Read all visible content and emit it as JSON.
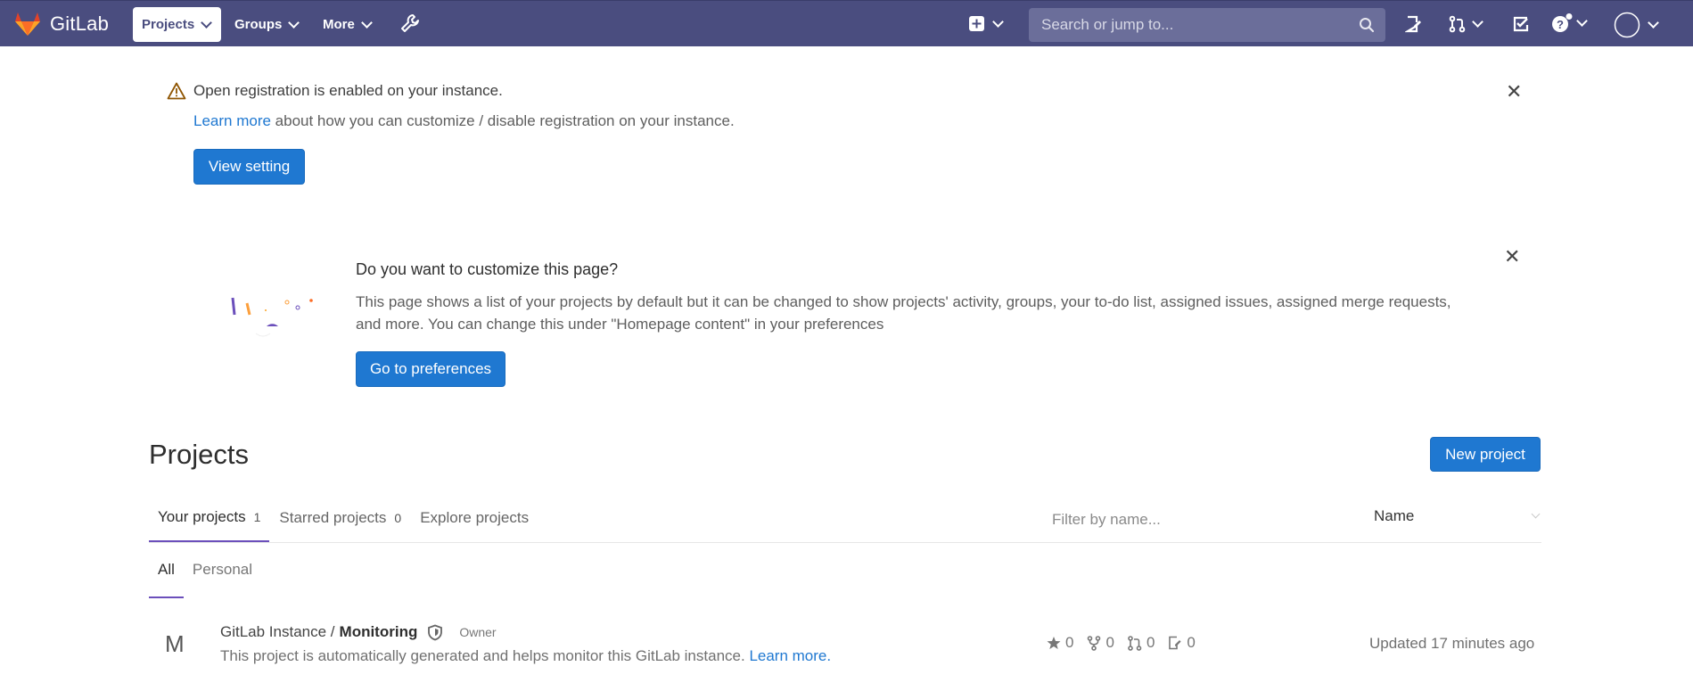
{
  "nav": {
    "brand": "GitLab",
    "projects_label": "Projects",
    "groups_label": "Groups",
    "more_label": "More",
    "search_placeholder": "Search or jump to...",
    "colors": {
      "bar": "#4a4d7f",
      "accent": "#1f78d1",
      "tab_underline": "#6b4fbb"
    }
  },
  "registration_alert": {
    "title": "Open registration is enabled on your instance.",
    "link_text": "Learn more",
    "body": " about how you can customize / disable registration on your instance.",
    "button": "View setting"
  },
  "customize": {
    "title": "Do you want to customize this page?",
    "body": "This page shows a list of your projects by default but it can be changed to show projects' activity, groups, your to-do list, assigned issues, assigned merge requests, and more. You can change this under \"Homepage content\" in your preferences",
    "button": "Go to preferences"
  },
  "projects": {
    "title": "Projects",
    "new_button": "New project",
    "tabs": [
      {
        "label": "Your projects",
        "count": "1"
      },
      {
        "label": "Starred projects",
        "count": "0"
      },
      {
        "label": "Explore projects"
      }
    ],
    "filter_placeholder": "Filter by name...",
    "sort_label": "Name",
    "subtabs": [
      "All",
      "Personal"
    ],
    "items": [
      {
        "avatar": "M",
        "namespace": "GitLab Instance /",
        "name": "Monitoring",
        "role": "Owner",
        "description": "This project is automatically generated and helps monitor this GitLab instance. ",
        "desc_link": "Learn more.",
        "stars": "0",
        "forks": "0",
        "merge_requests": "0",
        "issues": "0",
        "updated": "Updated 17 minutes ago"
      }
    ]
  }
}
